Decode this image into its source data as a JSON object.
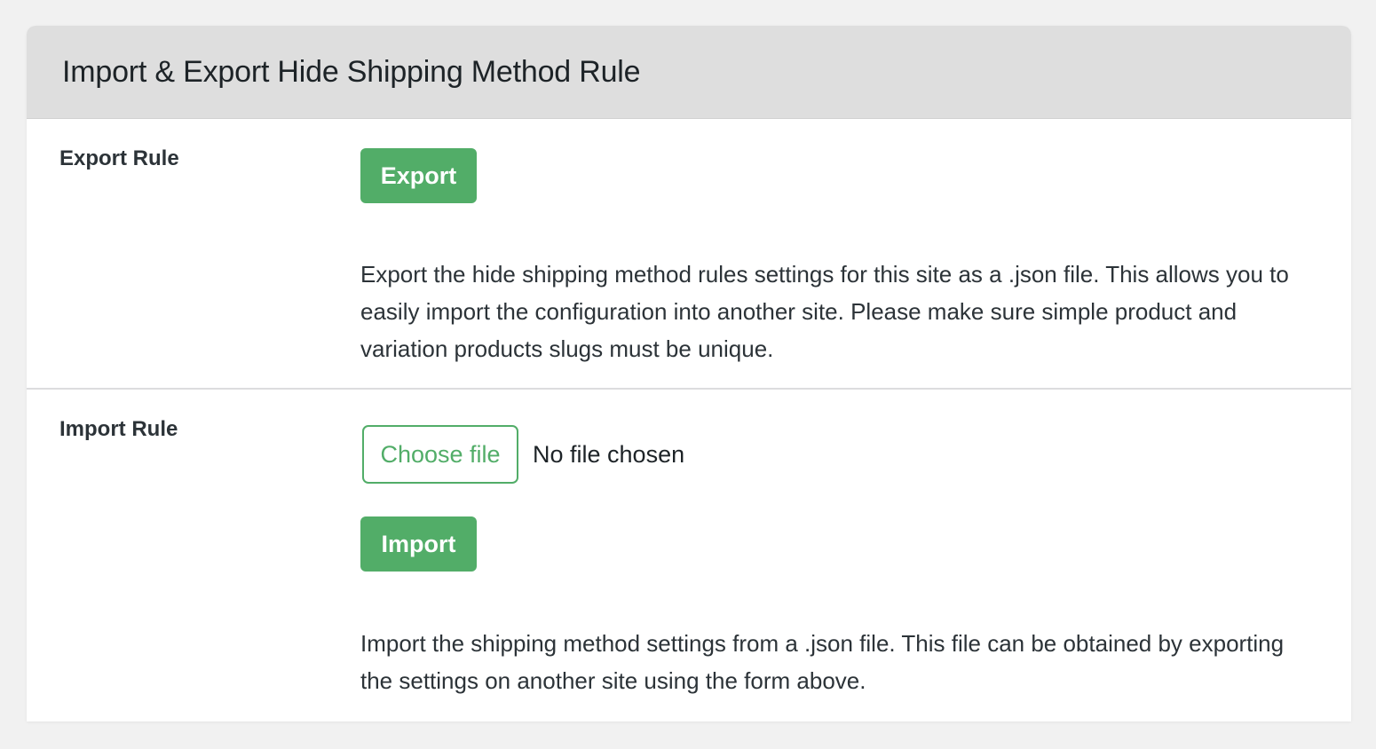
{
  "panel": {
    "title": "Import & Export Hide Shipping Method Rule"
  },
  "export_section": {
    "label": "Export Rule",
    "button_label": "Export",
    "description": "Export the hide shipping method rules settings for this site as a .json file. This allows you to easily import the configuration into another site. Please make sure simple product and variation products slugs must be unique."
  },
  "import_section": {
    "label": "Import Rule",
    "file_input": {
      "button_label": "Choose file",
      "status": "No file chosen"
    },
    "button_label": "Import",
    "description": "Import the shipping method settings from a .json file. This file can be obtained by exporting the settings on another site using the form above."
  },
  "colors": {
    "accent": "#52ad68",
    "header_bg": "#dedede",
    "page_bg": "#f1f1f1"
  }
}
